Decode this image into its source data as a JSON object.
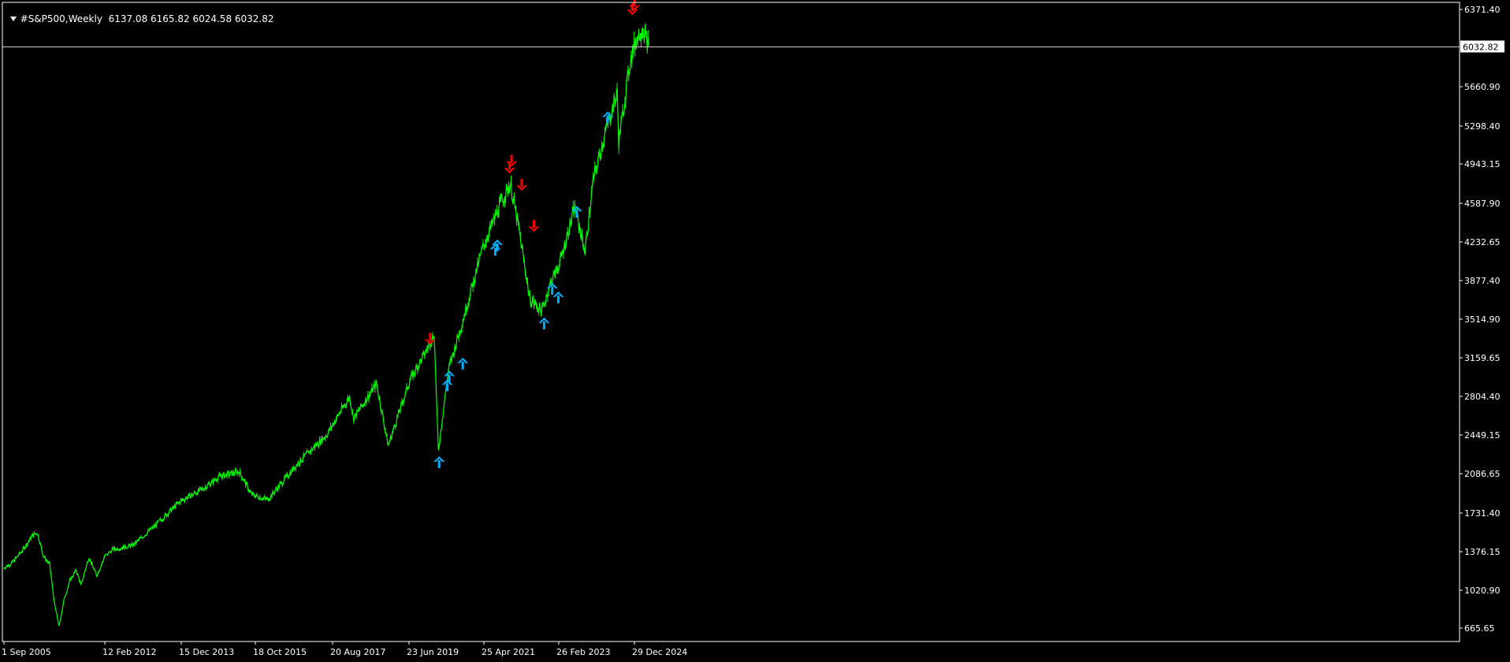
{
  "header": {
    "symbol": "#S&P500,Weekly",
    "ohlc": "6137.08 6165.82 6024.58 6032.82"
  },
  "colors": {
    "background": "#000000",
    "frame": "#ffffff",
    "price_line": "#00ff00",
    "arrow_up": "#00b0ff",
    "arrow_down": "#ff0000",
    "text": "#ffffff",
    "current_marker_bg": "#ffffff",
    "current_marker_text": "#000000"
  },
  "chart_data": {
    "type": "line",
    "title": "#S&P500,Weekly",
    "x_tick_labels": [
      "1 Sep 2005",
      "12 Feb 2012",
      "15 Dec 2013",
      "18 Oct 2015",
      "20 Aug 2017",
      "23 Jun 2019",
      "25 Apr 2021",
      "26 Feb 2023",
      "29 Dec 2024"
    ],
    "y_tick_labels": [
      "6371.40",
      "5660.90",
      "5298.40",
      "4943.15",
      "4587.90",
      "4232.65",
      "3877.40",
      "3514.90",
      "3159.65",
      "2804.40",
      "2449.15",
      "2086.65",
      "1731.40",
      "1376.15",
      "1020.90",
      "665.65"
    ],
    "ylim": [
      600,
      6400
    ],
    "current_price": 6032.82,
    "current_price_label": "6032.82",
    "grid": false,
    "series": [
      {
        "values": [
          [
            2005.67,
            1220
          ],
          [
            2006.2,
            1270
          ],
          [
            2006.9,
            1390
          ],
          [
            2007.5,
            1520
          ],
          [
            2007.8,
            1550
          ],
          [
            2008.2,
            1330
          ],
          [
            2008.6,
            1250
          ],
          [
            2008.9,
            890
          ],
          [
            2009.2,
            680
          ],
          [
            2009.5,
            920
          ],
          [
            2009.9,
            1110
          ],
          [
            2010.3,
            1200
          ],
          [
            2010.6,
            1060
          ],
          [
            2011.1,
            1320
          ],
          [
            2011.6,
            1150
          ],
          [
            2011.9,
            1250
          ],
          [
            2012.3,
            1390
          ],
          [
            2012.8,
            1430
          ],
          [
            2013.3,
            1600
          ],
          [
            2013.95,
            1840
          ],
          [
            2014.5,
            1950
          ],
          [
            2014.9,
            2060
          ],
          [
            2015.4,
            2110
          ],
          [
            2015.7,
            1900
          ],
          [
            2016.1,
            1850
          ],
          [
            2016.8,
            2180
          ],
          [
            2017.5,
            2450
          ],
          [
            2018.05,
            2800
          ],
          [
            2018.15,
            2600
          ],
          [
            2018.7,
            2920
          ],
          [
            2018.98,
            2350
          ],
          [
            2019.5,
            2950
          ],
          [
            2019.9,
            3220
          ],
          [
            2020.1,
            3380
          ],
          [
            2020.2,
            2300
          ],
          [
            2020.45,
            3050
          ],
          [
            2020.8,
            3500
          ],
          [
            2021.3,
            4180
          ],
          [
            2021.7,
            4550
          ],
          [
            2021.97,
            4770
          ],
          [
            2022.2,
            4300
          ],
          [
            2022.45,
            3700
          ],
          [
            2022.75,
            3590
          ],
          [
            2022.95,
            3840
          ],
          [
            2023.2,
            4050
          ],
          [
            2023.55,
            4550
          ],
          [
            2023.8,
            4140
          ],
          [
            2024.0,
            4800
          ],
          [
            2024.3,
            5250
          ],
          [
            2024.58,
            5600
          ],
          [
            2024.62,
            5150
          ],
          [
            2024.9,
            5900
          ],
          [
            2025.05,
            6100
          ],
          [
            2025.2,
            6200
          ],
          [
            2025.35,
            6032
          ]
        ]
      }
    ],
    "signals": [
      {
        "type": "down",
        "x": 2020.0,
        "y": 3280
      },
      {
        "type": "up",
        "x": 2020.22,
        "y": 2250
      },
      {
        "type": "up",
        "x": 2020.42,
        "y": 2960
      },
      {
        "type": "up",
        "x": 2020.47,
        "y": 3040
      },
      {
        "type": "up",
        "x": 2020.8,
        "y": 3160
      },
      {
        "type": "up",
        "x": 2021.6,
        "y": 4210
      },
      {
        "type": "up",
        "x": 2021.65,
        "y": 4250
      },
      {
        "type": "down",
        "x": 2021.95,
        "y": 4860
      },
      {
        "type": "down",
        "x": 2022.0,
        "y": 4920
      },
      {
        "type": "down",
        "x": 2022.25,
        "y": 4700
      },
      {
        "type": "down",
        "x": 2022.55,
        "y": 4320
      },
      {
        "type": "up",
        "x": 2022.8,
        "y": 3530
      },
      {
        "type": "up",
        "x": 2023.0,
        "y": 3850
      },
      {
        "type": "up",
        "x": 2023.15,
        "y": 3770
      },
      {
        "type": "up",
        "x": 2023.6,
        "y": 4560
      },
      {
        "type": "up",
        "x": 2024.35,
        "y": 5430
      },
      {
        "type": "down",
        "x": 2024.95,
        "y": 6320
      },
      {
        "type": "down",
        "x": 2025.0,
        "y": 6360
      }
    ]
  }
}
